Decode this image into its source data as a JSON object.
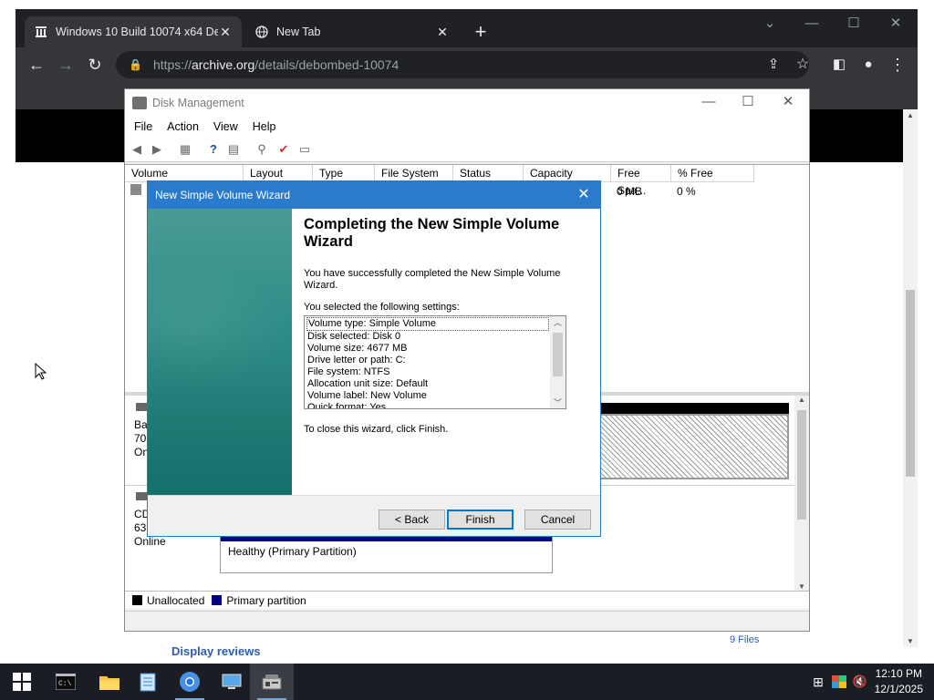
{
  "browser": {
    "tabs": [
      {
        "title": "Windows 10 Build 10074 x64 Del",
        "favicon": "archive-icon",
        "active": true
      },
      {
        "title": "New Tab",
        "favicon": "globe-icon",
        "active": false
      }
    ],
    "url_prefix": "https://",
    "url_host": "archive.org",
    "url_path": "/details/debombed-10074",
    "page_links": {
      "display_reviews": "Display reviews",
      "files": "9 Files"
    }
  },
  "disk_management": {
    "title": "Disk Management",
    "menu": [
      "File",
      "Action",
      "View",
      "Help"
    ],
    "columns": [
      "Volume",
      "Layout",
      "Type",
      "File System",
      "Status",
      "Capacity",
      "Free Spa...",
      "% Free"
    ],
    "row": {
      "free_space": "0 MB",
      "percent_free": "0 %"
    },
    "disk0_label": [
      "Ba",
      "70.",
      "On"
    ],
    "cdrom_label": [
      "CD",
      "63",
      "Online"
    ],
    "partition_status": "Healthy (Primary Partition)",
    "legend": [
      {
        "label": "Unallocated",
        "color": "#000000"
      },
      {
        "label": "Primary partition",
        "color": "#000080"
      }
    ]
  },
  "wizard": {
    "title": "New Simple Volume Wizard",
    "heading": "Completing the New Simple Volume Wizard",
    "success_text": "You have successfully completed the New Simple Volume Wizard.",
    "settings_label": "You selected the following settings:",
    "settings": [
      "Volume type: Simple Volume",
      "Disk selected: Disk 0",
      "Volume size: 4677 MB",
      "Drive letter or path: C:",
      "File system: NTFS",
      "Allocation unit size: Default",
      "Volume label: New Volume",
      "Quick format: Yes"
    ],
    "close_text": "To close this wizard, click Finish.",
    "buttons": {
      "back": "< Back",
      "finish": "Finish",
      "cancel": "Cancel"
    }
  },
  "taskbar": {
    "time": "12:10 PM",
    "date": "12/1/2025"
  }
}
